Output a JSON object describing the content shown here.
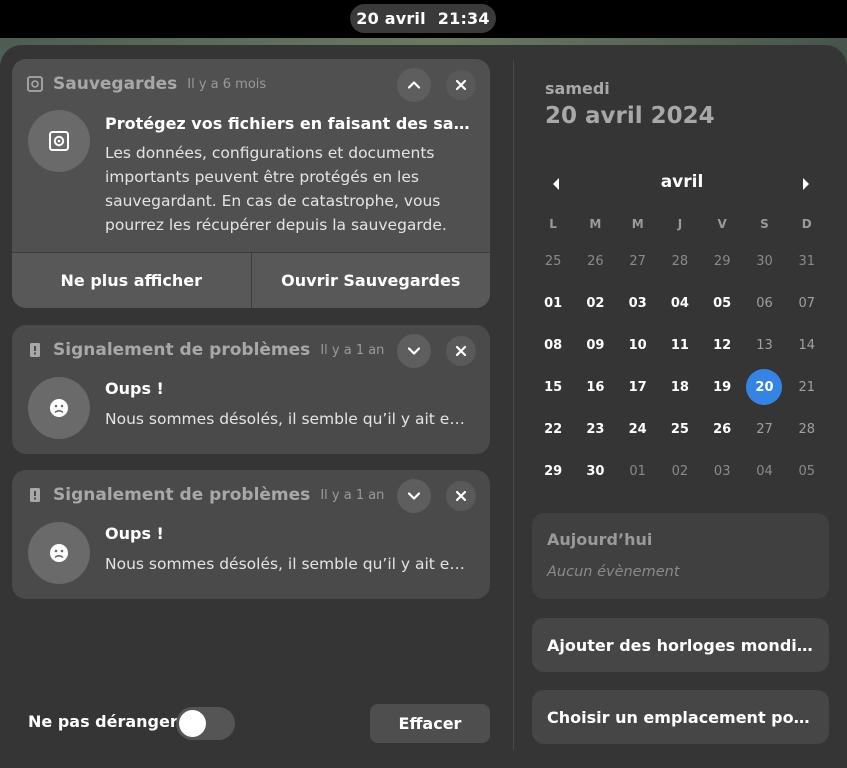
{
  "topbar": {
    "date": "20 avril",
    "time": "21:34"
  },
  "notifications": [
    {
      "app_name": "Sauvegardes",
      "time_ago": "Il y a 6 mois",
      "icon": "safe-icon",
      "title": "Protégez vos fichiers en faisant des sauvegardes",
      "body": "Les données, configurations et documents importants peuvent être protégés en les sauvegardant. En cas de catastrophe, vous pourrez les récupérer depuis la sauvegarde.",
      "actions": [
        "Ne plus afficher",
        "Ouvrir Sauvegardes"
      ]
    },
    {
      "app_name": "Signalement de problèmes",
      "time_ago": "Il y a 1 an",
      "icon": "sad-face-icon",
      "title": "Oups !",
      "body": "Nous sommes désolés, il semble qu’il y ait eu un problème."
    },
    {
      "app_name": "Signalement de problèmes",
      "time_ago": "Il y a 1 an",
      "icon": "sad-face-icon",
      "title": "Oups !",
      "body": "Nous sommes désolés, il semble qu’il y ait eu un problème."
    }
  ],
  "footer": {
    "dnd_label": "Ne pas déranger",
    "dnd_enabled": false,
    "clear_label": "Effacer"
  },
  "calendar": {
    "weekday": "samedi",
    "full_date": "20 avril 2024",
    "month": "avril",
    "day_headers": [
      "L",
      "M",
      "M",
      "J",
      "V",
      "S",
      "D"
    ],
    "weeks": [
      [
        "25",
        "26",
        "27",
        "28",
        "29",
        "30",
        "31"
      ],
      [
        "01",
        "02",
        "03",
        "04",
        "05",
        "06",
        "07"
      ],
      [
        "08",
        "09",
        "10",
        "11",
        "12",
        "13",
        "14"
      ],
      [
        "15",
        "16",
        "17",
        "18",
        "19",
        "20",
        "21"
      ],
      [
        "22",
        "23",
        "24",
        "25",
        "26",
        "27",
        "28"
      ],
      [
        "29",
        "30",
        "01",
        "02",
        "03",
        "04",
        "05"
      ]
    ],
    "today": "20",
    "accent_color": "#3584e4"
  },
  "events": {
    "title": "Aujourd’hui",
    "empty": "Aucun évènement"
  },
  "world_clocks_label": "Ajouter des horloges mondiales…",
  "weather_label": "Choisir un emplacement pour la météo…"
}
